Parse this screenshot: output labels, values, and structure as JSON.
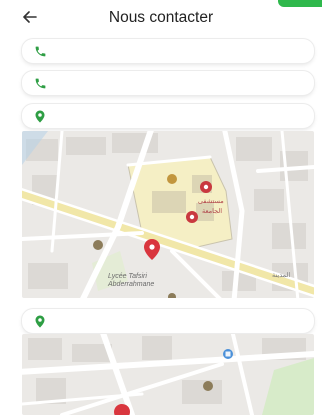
{
  "header": {
    "title": "Nous contacter"
  },
  "contact_fields": [
    {
      "icon": "phone-icon",
      "value": ""
    },
    {
      "icon": "phone-icon",
      "value": ""
    },
    {
      "icon": "location-pin-icon",
      "value": ""
    }
  ],
  "location_field_2": {
    "icon": "location-pin-icon",
    "value": ""
  },
  "map1": {
    "place_label": "Lycée Tafsiri Abderrahmane",
    "arabic_labels": [
      "مستشفى",
      "الجامعة",
      "المدينة"
    ]
  },
  "colors": {
    "accent": "#2fb84c",
    "icon_green": "#2e9e44",
    "pin_red": "#d9363e"
  }
}
